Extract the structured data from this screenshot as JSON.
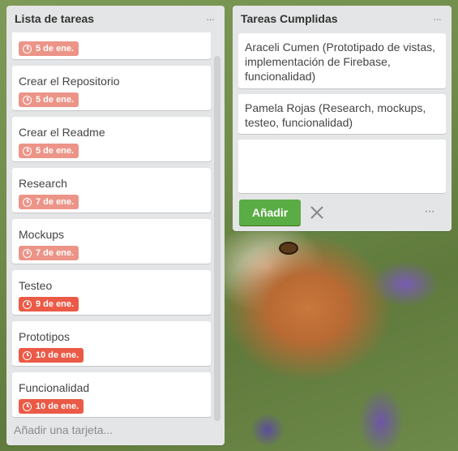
{
  "lists": {
    "pending": {
      "title": "Lista de tareas",
      "menu": "···",
      "add_card": "Añadir una tarjeta...",
      "cards": [
        {
          "title": "",
          "due": "5 de ene.",
          "status": "soon"
        },
        {
          "title": "Crear el Repositorio",
          "due": "5 de ene.",
          "status": "soon"
        },
        {
          "title": "Crear el Readme",
          "due": "5 de ene.",
          "status": "soon"
        },
        {
          "title": "Research",
          "due": "7 de ene.",
          "status": "soon"
        },
        {
          "title": "Mockups",
          "due": "7 de ene.",
          "status": "soon"
        },
        {
          "title": "Testeo",
          "due": "9 de ene.",
          "status": "due"
        },
        {
          "title": "Prototipos",
          "due": "10 de ene.",
          "status": "due"
        },
        {
          "title": "Funcionalidad",
          "due": "10 de ene.",
          "status": "due"
        }
      ]
    },
    "done": {
      "title": "Tareas Cumplidas",
      "menu": "···",
      "cards": [
        {
          "title": "Araceli Cumen (Prototipado de vistas, implementación de Firebase, funcionalidad)"
        },
        {
          "title": "Pamela Rojas (Research, mockups, testeo, funcionalidad)"
        }
      ],
      "composer_value": "",
      "add_button": "Añadir",
      "more": "···"
    }
  },
  "colors": {
    "due_soon": "#ec9488",
    "overdue": "#eb5a46",
    "add_button": "#5aac44"
  },
  "icons": [
    "clock-icon",
    "close-icon",
    "more-icon",
    "menu-dots-icon"
  ]
}
